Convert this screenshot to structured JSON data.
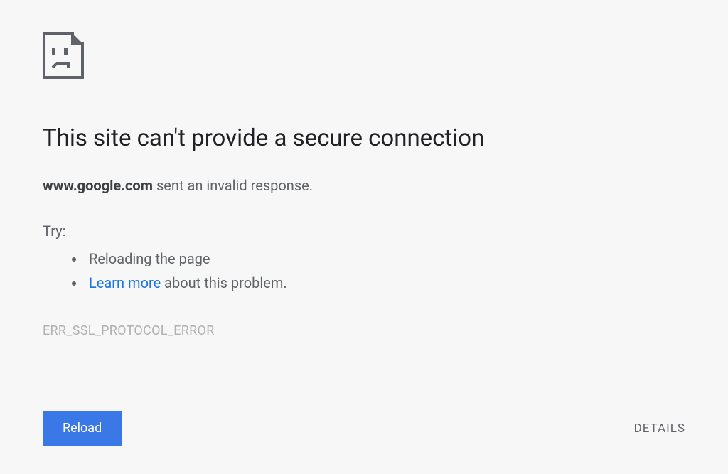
{
  "error": {
    "heading": "This site can't provide a secure connection",
    "host": "www.google.com",
    "host_message": " sent an invalid response.",
    "try_label": "Try:",
    "suggestions": {
      "reload": "Reloading the page",
      "learn_more_link": "Learn more",
      "learn_more_rest": " about this problem."
    },
    "code": "ERR_SSL_PROTOCOL_ERROR"
  },
  "buttons": {
    "reload": "Reload",
    "details": "DETAILS"
  }
}
